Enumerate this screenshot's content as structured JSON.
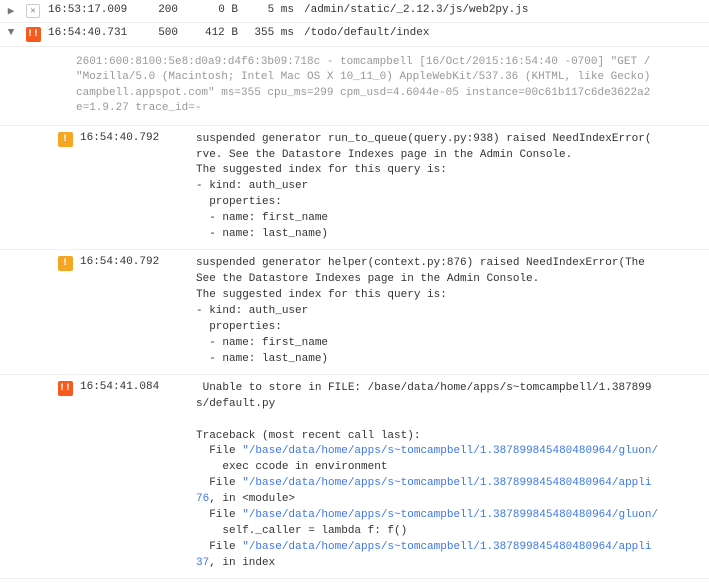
{
  "rows": [
    {
      "expandIcon": "▶",
      "levelIcon": "✕",
      "levelType": "x",
      "timestamp": "16:53:17.009",
      "status": "200",
      "bytes": "0 B",
      "duration": "5 ms",
      "path": "/admin/static/_2.12.3/js/web2py.js"
    },
    {
      "expandIcon": "▼",
      "levelIcon": "!!",
      "levelType": "error",
      "timestamp": "16:54:40.731",
      "status": "500",
      "bytes": "412 B",
      "duration": "355 ms",
      "path": "/todo/default/index"
    }
  ],
  "detailText": "2601:600:8100:5e8:d0a9:d4f6:3b09:718c - tomcampbell [16/Oct/2015:16:54:40 -0700] \"GET /\n\"Mozilla/5.0 (Macintosh; Intel Mac OS X 10_11_0) AppleWebKit/537.36 (KHTML, like Gecko)\ncampbell.appspot.com\" ms=355 cpu_ms=299 cpm_usd=4.6044e-05 instance=00c61b117c6de3622a2\ne=1.9.27 trace_id=-",
  "subs": [
    {
      "levelIcon": "!",
      "levelType": "warn",
      "timestamp": "16:54:40.792",
      "msg": "suspended generator run_to_queue(query.py:938) raised NeedIndexError(\nrve. See the Datastore Indexes page in the Admin Console.\nThe suggested index for this query is:\n- kind: auth_user\n  properties:\n  - name: first_name\n  - name: last_name)"
    },
    {
      "levelIcon": "!",
      "levelType": "warn",
      "timestamp": "16:54:40.792",
      "msg": "suspended generator helper(context.py:876) raised NeedIndexError(The \nSee the Datastore Indexes page in the Admin Console.\nThe suggested index for this query is:\n- kind: auth_user\n  properties:\n  - name: first_name\n  - name: last_name)"
    }
  ],
  "traceback": {
    "levelIcon": "!!",
    "levelType": "error",
    "timestamp": "16:54:41.084",
    "header": " Unable to store in FILE: /base/data/home/apps/s~tomcampbell/1.387899\ns/default.py\n\nTraceback (most recent call last):",
    "lines": [
      {
        "prefix": "  File ",
        "link": "\"/base/data/home/apps/s~tomcampbell/1.387899845480480964/gluon/",
        "tail": "    exec ccode in environment"
      },
      {
        "prefix": "  File ",
        "link": "\"/base/data/home/apps/s~tomcampbell/1.387899845480480964/appli",
        "line": "76",
        "suffix": ", in <module>"
      },
      {
        "prefix": "  File ",
        "link": "\"/base/data/home/apps/s~tomcampbell/1.387899845480480964/gluon/",
        "tail": "    self._caller = lambda f: f()"
      },
      {
        "prefix": "  File ",
        "link": "\"/base/data/home/apps/s~tomcampbell/1.387899845480480964/appli",
        "line": "37",
        "suffix": ", in index"
      }
    ]
  }
}
